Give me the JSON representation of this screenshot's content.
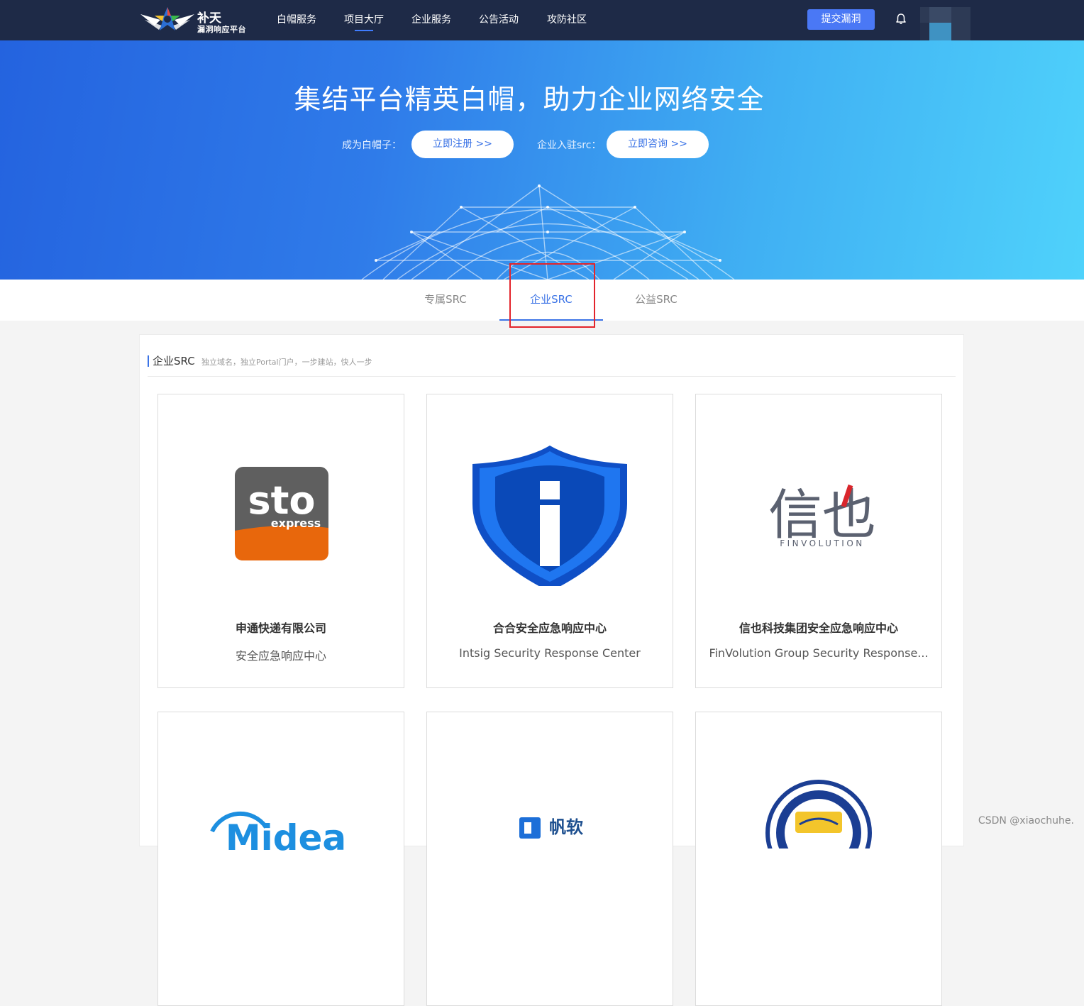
{
  "header": {
    "logo_title": "补天",
    "logo_subtitle": "漏洞响应平台",
    "nav": [
      {
        "label": "白帽服务"
      },
      {
        "label": "项目大厅"
      },
      {
        "label": "企业服务"
      },
      {
        "label": "公告活动"
      },
      {
        "label": "攻防社区"
      }
    ],
    "active_nav": "项目大厅",
    "submit_label": "提交漏洞"
  },
  "banner": {
    "title": "集结平台精英白帽，助力企业网络安全",
    "whitehat_label": "成为白帽子：",
    "register_label": "立即注册 >>",
    "enterprise_label": "企业入驻src：",
    "consult_label": "立即咨询 >>"
  },
  "tabs": [
    {
      "label": "专属SRC"
    },
    {
      "label": "企业SRC"
    },
    {
      "label": "公益SRC"
    }
  ],
  "active_tab": "企业SRC",
  "section": {
    "title": "企业SRC",
    "subtitle": "独立域名，独立Portal门户，一步建站，快人一步"
  },
  "cards": [
    {
      "name": "申通快递有限公司",
      "desc": "安全应急响应中心",
      "logo": "sto-express-logo",
      "logo_text": "sto",
      "logo_text2": "express"
    },
    {
      "name": "合合安全应急响应中心",
      "desc": "Intsig Security Response Center",
      "logo": "intsig-shield-logo"
    },
    {
      "name": "信也科技集团安全应急响应中心",
      "desc": "FinVolution Group Security Response...",
      "logo": "finvolution-logo",
      "logo_text": "信也",
      "logo_text2": "FINVOLUTION"
    },
    {
      "name": "",
      "desc": "",
      "logo": "midea-logo",
      "logo_text": "Midea"
    },
    {
      "name": "",
      "desc": "",
      "logo": "fanruan-logo",
      "logo_text": "帆软"
    },
    {
      "name": "",
      "desc": "",
      "logo": "tiger-seal-logo"
    }
  ],
  "watermark": "CSDN @xiaochuhe.",
  "colors": {
    "nav_bg": "#1e2a47",
    "accent": "#3b73e6",
    "highlight": "#e3242b",
    "sto_orange": "#e8670c",
    "sto_grey": "#5f5f5f",
    "intsig_blue": "#1160e0",
    "finvolution_grey": "#5b6170",
    "finvolution_red": "#d9262c"
  }
}
